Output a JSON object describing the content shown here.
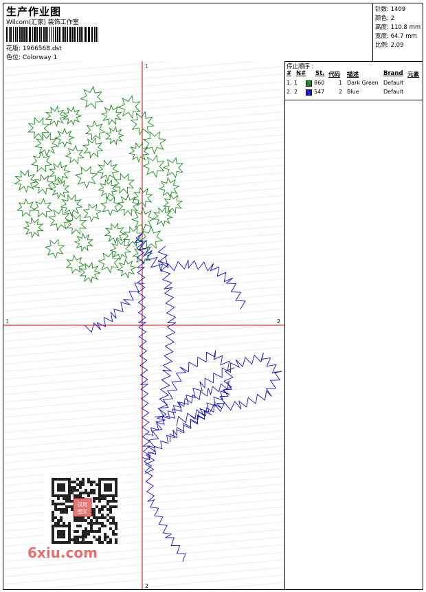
{
  "header": {
    "title": "生产作业图",
    "company": "Wilcom(汇家) 装饰工作室",
    "design_label": "花版: 1966568.dst",
    "colorway_label": "色位: Colorway 1"
  },
  "stats": {
    "stitches": "针数: 1409",
    "colors": "颜色: 2",
    "height": "高度: 110.8 mm",
    "width": "宽度: 64.7 mm",
    "scale": "比例: 2.09"
  },
  "stop_sequence": {
    "title": "停止顺序 :",
    "columns": [
      "#",
      "N#",
      "St.",
      "代码",
      "描述",
      "Brand",
      "元素"
    ],
    "rows": [
      {
        "idx": "1.",
        "n": "1",
        "st": "860",
        "code": "1",
        "desc": "Dark Green",
        "brand": "Default",
        "color": "#1a8c1a"
      },
      {
        "idx": "2.",
        "n": "2",
        "st": "547",
        "code": "2",
        "desc": "Blue",
        "brand": "Default",
        "color": "#1a1ad4"
      }
    ]
  },
  "axes": {
    "top": "1",
    "bottom": "2",
    "left": "1",
    "right": "2"
  },
  "watermark": {
    "text": "6xiu.com",
    "seal": "汉风图文"
  },
  "colors": {
    "green": "#1a8c1a",
    "blue": "#1010cc",
    "axis": "#d40000"
  }
}
